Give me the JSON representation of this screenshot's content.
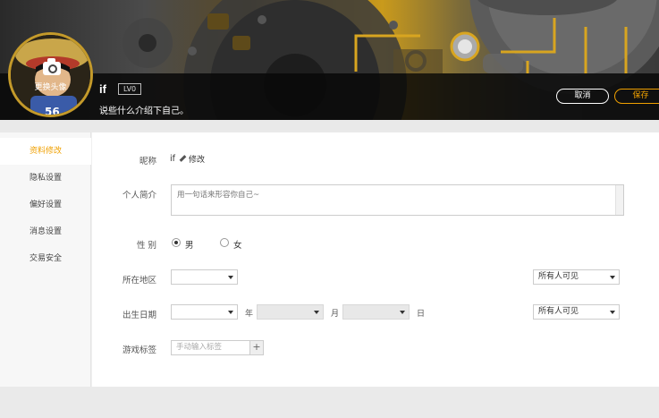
{
  "profile": {
    "avatar_label": "更换头像",
    "username": "if",
    "level": "LV0",
    "bio_line": "说些什么介绍下自己。"
  },
  "actions": {
    "cancel_label": "取消",
    "save_label": "保存"
  },
  "sidebar": {
    "items": [
      {
        "label": "资料修改",
        "active": true
      },
      {
        "label": "隐私设置",
        "active": false
      },
      {
        "label": "偏好设置",
        "active": false
      },
      {
        "label": "消息设置",
        "active": false
      },
      {
        "label": "交易安全",
        "active": false
      }
    ]
  },
  "form": {
    "nickname": {
      "label": "昵称",
      "value": "if",
      "edit_label": "修改"
    },
    "intro": {
      "label": "个人简介",
      "placeholder": "用一句话来形容你自己~"
    },
    "gender": {
      "label": "性 别",
      "options": [
        "男",
        "女"
      ],
      "selected": "男"
    },
    "region": {
      "label": "所在地区",
      "value": "",
      "visibility": "所有人可见"
    },
    "birthday": {
      "label": "出生日期",
      "year_unit": "年",
      "month_unit": "月",
      "day_unit": "日",
      "visibility": "所有人可见"
    },
    "tags": {
      "label": "游戏标签",
      "placeholder": "手动输入标签",
      "add": "+"
    }
  },
  "colors": {
    "accent": "#f0a000",
    "banner_overlay": "#080808"
  }
}
